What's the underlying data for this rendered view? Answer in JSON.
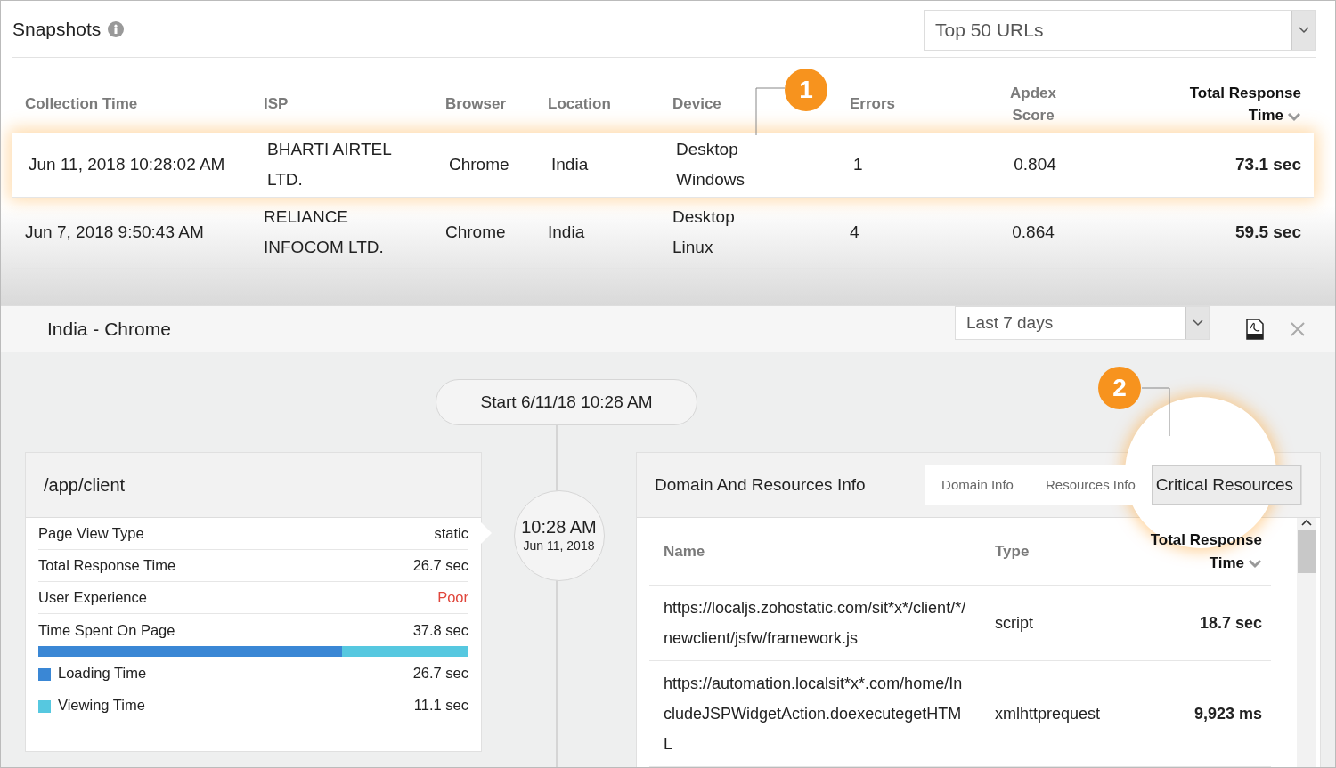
{
  "snapshots": {
    "title": "Snapshots",
    "url_filter": "Top 50 URLs",
    "callout": "1",
    "columns": [
      {
        "label": "Collection Time",
        "sorted": false
      },
      {
        "label": "ISP",
        "sorted": false
      },
      {
        "label": "Browser",
        "sorted": false
      },
      {
        "label": "Location",
        "sorted": false
      },
      {
        "label": "Device",
        "sorted": false
      },
      {
        "label": "Errors",
        "sorted": false
      },
      {
        "label": "Apdex Score",
        "sorted": false
      },
      {
        "label": "Total Response Time",
        "sorted": true
      }
    ],
    "rows": [
      {
        "collection_time": "Jun 11, 2018 10:28:02 AM",
        "isp": "BHARTI AIRTEL LTD.",
        "browser": "Chrome",
        "location": "India",
        "device": "Desktop Windows",
        "errors": "1",
        "apdex_score": "0.804",
        "total_response_time": "73.1 sec",
        "selected": true
      },
      {
        "collection_time": "Jun 7, 2018 9:50:43 AM",
        "isp": "RELIANCE INFOCOM LTD.",
        "browser": "Chrome",
        "location": "India",
        "device": "Desktop Linux",
        "errors": "4",
        "apdex_score": "0.864",
        "total_response_time": "59.5 sec",
        "selected": false
      }
    ]
  },
  "detail": {
    "title": "India - Chrome",
    "period": "Last 7 days",
    "start": "Start 6/11/18 10:28 AM",
    "node": {
      "time": "10:28 AM",
      "date": "Jun 11, 2018"
    },
    "page_card": {
      "title": "/app/client",
      "rows": [
        {
          "label": "Page View Type",
          "value": "static",
          "kind": "plain"
        },
        {
          "label": "Total Response Time",
          "value": "26.7 sec",
          "kind": "plain"
        },
        {
          "label": "User Experience",
          "value": "Poor",
          "kind": "alert"
        },
        {
          "label": "Time Spent On Page",
          "value": "37.8 sec",
          "kind": "plain"
        }
      ],
      "time_bar": {
        "level": 0.706
      },
      "legend": [
        {
          "label": "Loading Time",
          "value": "26.7 sec",
          "color": "#3a87d5"
        },
        {
          "label": "Viewing Time",
          "value": "11.1 sec",
          "color": "#56c8e0"
        }
      ]
    },
    "resources": {
      "title": "Domain And Resources Info",
      "callout": "2",
      "tabs": [
        {
          "label": "Domain Info",
          "selected": false
        },
        {
          "label": "Resources Info",
          "selected": false
        },
        {
          "label": "Critical Resources",
          "selected": true
        }
      ],
      "columns": [
        {
          "label": "Name",
          "sorted": false
        },
        {
          "label": "Type",
          "sorted": false
        },
        {
          "label": "Total Response Time",
          "sorted": true
        }
      ],
      "rows": [
        {
          "name": "https://localjs.zohostatic.com/sit*x*/client/*/newclient/jsfw/framework.js",
          "type": "script",
          "total_response_time": "18.7 sec"
        },
        {
          "name": "https://automation.localsit*x*.com/home/IncludeJSPWidgetAction.doexecutegetHTML",
          "type": "xmlhttprequest",
          "total_response_time": "9,923 ms"
        }
      ]
    }
  }
}
